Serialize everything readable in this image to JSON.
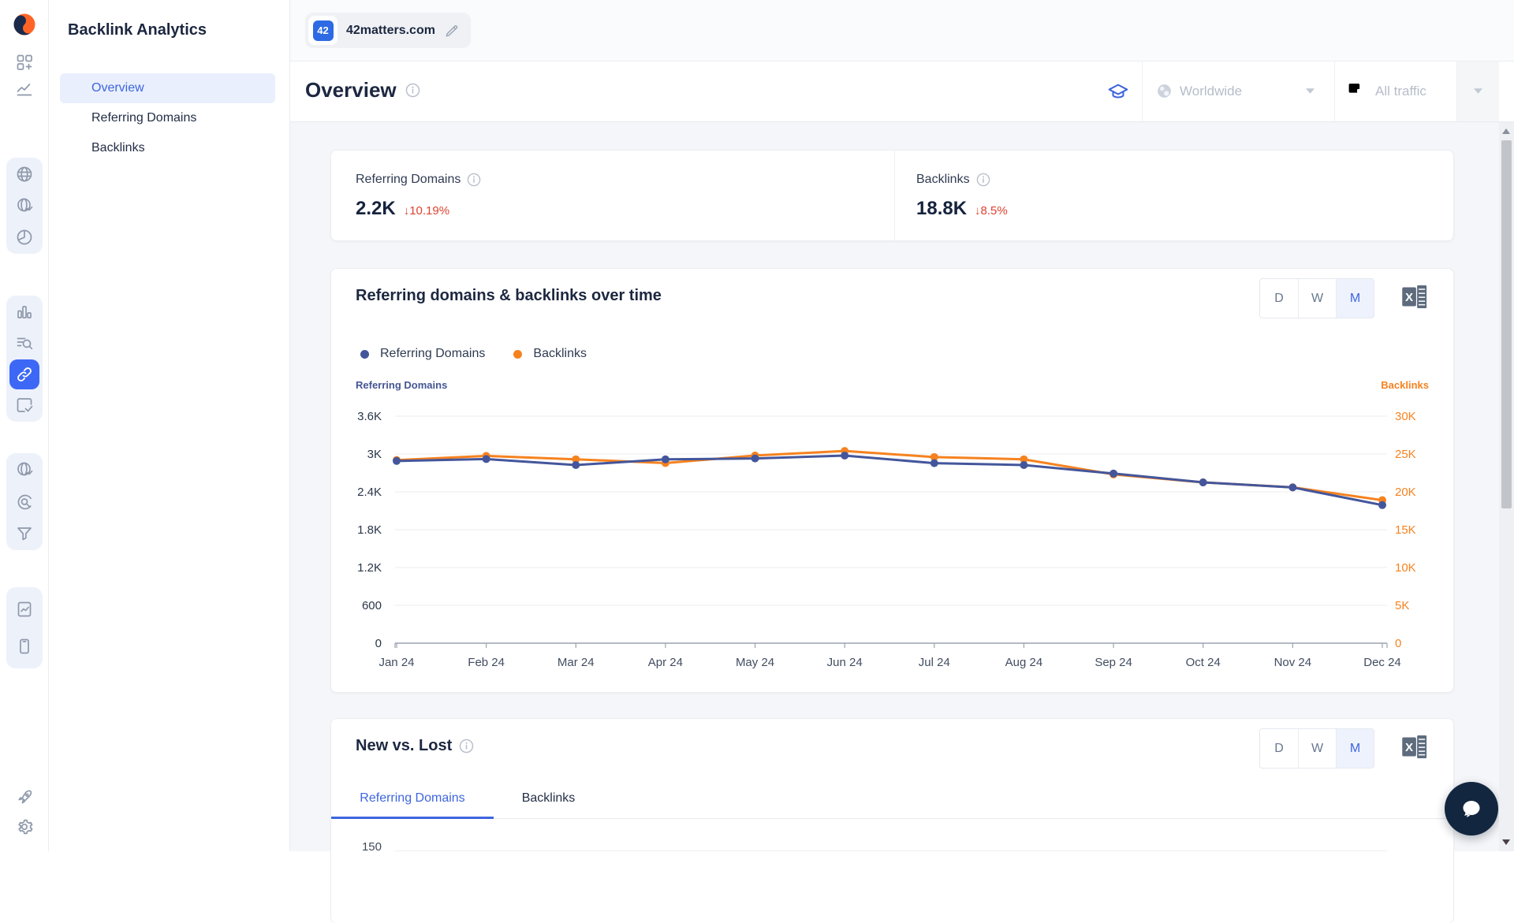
{
  "sidebar": {
    "title": "Backlink Analytics",
    "items": [
      {
        "label": "Overview",
        "active": true
      },
      {
        "label": "Referring Domains",
        "active": false
      },
      {
        "label": "Backlinks",
        "active": false
      }
    ]
  },
  "topbar": {
    "project_badge": "42",
    "domain": "42matters.com"
  },
  "header": {
    "title": "Overview",
    "location_filter": "Worldwide",
    "traffic_filter": "All traffic"
  },
  "summary_cards": [
    {
      "label": "Referring Domains",
      "value": "2.2K",
      "change": "↓10.19%"
    },
    {
      "label": "Backlinks",
      "value": "18.8K",
      "change": "↓8.5%"
    }
  ],
  "overtime_section": {
    "title": "Referring domains & backlinks over time",
    "granularity_options": [
      "D",
      "W",
      "M"
    ],
    "granularity_active": "M",
    "legend": [
      {
        "label": "Referring Domains",
        "color": "#44569b"
      },
      {
        "label": "Backlinks",
        "color": "#f6821f"
      }
    ],
    "left_axis_title": "Referring Domains",
    "right_axis_title": "Backlinks"
  },
  "chart_data": [
    {
      "type": "line",
      "title": "Referring domains & backlinks over time",
      "x": [
        "Jan 24",
        "Feb 24",
        "Mar 24",
        "Apr 24",
        "May 24",
        "Jun 24",
        "Jul 24",
        "Aug 24",
        "Sep 24",
        "Oct 24",
        "Nov 24",
        "Dec 24"
      ],
      "series": [
        {
          "name": "Referring Domains",
          "axis": "left",
          "color": "#44569b",
          "values": [
            2890,
            2920,
            2825,
            2915,
            2930,
            2975,
            2855,
            2825,
            2690,
            2550,
            2470,
            2190
          ]
        },
        {
          "name": "Backlinks",
          "axis": "right",
          "color": "#f6821f",
          "values": [
            24200,
            24750,
            24300,
            23800,
            24800,
            25400,
            24600,
            24300,
            22300,
            21250,
            20600,
            18900
          ]
        }
      ],
      "left_axis": {
        "title": "Referring Domains",
        "min": 0,
        "max": 3600,
        "ticks": [
          0,
          600,
          1200,
          1800,
          2400,
          3000,
          3600
        ],
        "tick_labels": [
          "0",
          "600",
          "1.2K",
          "1.8K",
          "2.4K",
          "3K",
          "3.6K"
        ]
      },
      "right_axis": {
        "title": "Backlinks",
        "min": 0,
        "max": 30000,
        "ticks": [
          0,
          5000,
          10000,
          15000,
          20000,
          25000,
          30000
        ],
        "tick_labels": [
          "0",
          "5K",
          "10K",
          "15K",
          "20K",
          "25K",
          "30K"
        ]
      },
      "grid": true,
      "legend_position": "top-left"
    }
  ],
  "new_vs_lost_section": {
    "title": "New vs. Lost",
    "tabs": [
      {
        "label": "Referring Domains",
        "active": true
      },
      {
        "label": "Backlinks",
        "active": false
      }
    ],
    "granularity_options": [
      "D",
      "W",
      "M"
    ],
    "granularity_active": "M",
    "first_y_tick": "150"
  },
  "colors": {
    "accent_blue": "#3e65de",
    "active_tile_blue": "#3d68f5",
    "line_blue": "#44569b",
    "orange": "#f6821f",
    "negative_red": "#dd4330",
    "navy_text": "#1c2740",
    "badge_blue": "#2d6ae3",
    "fab_navy": "#13263f"
  }
}
